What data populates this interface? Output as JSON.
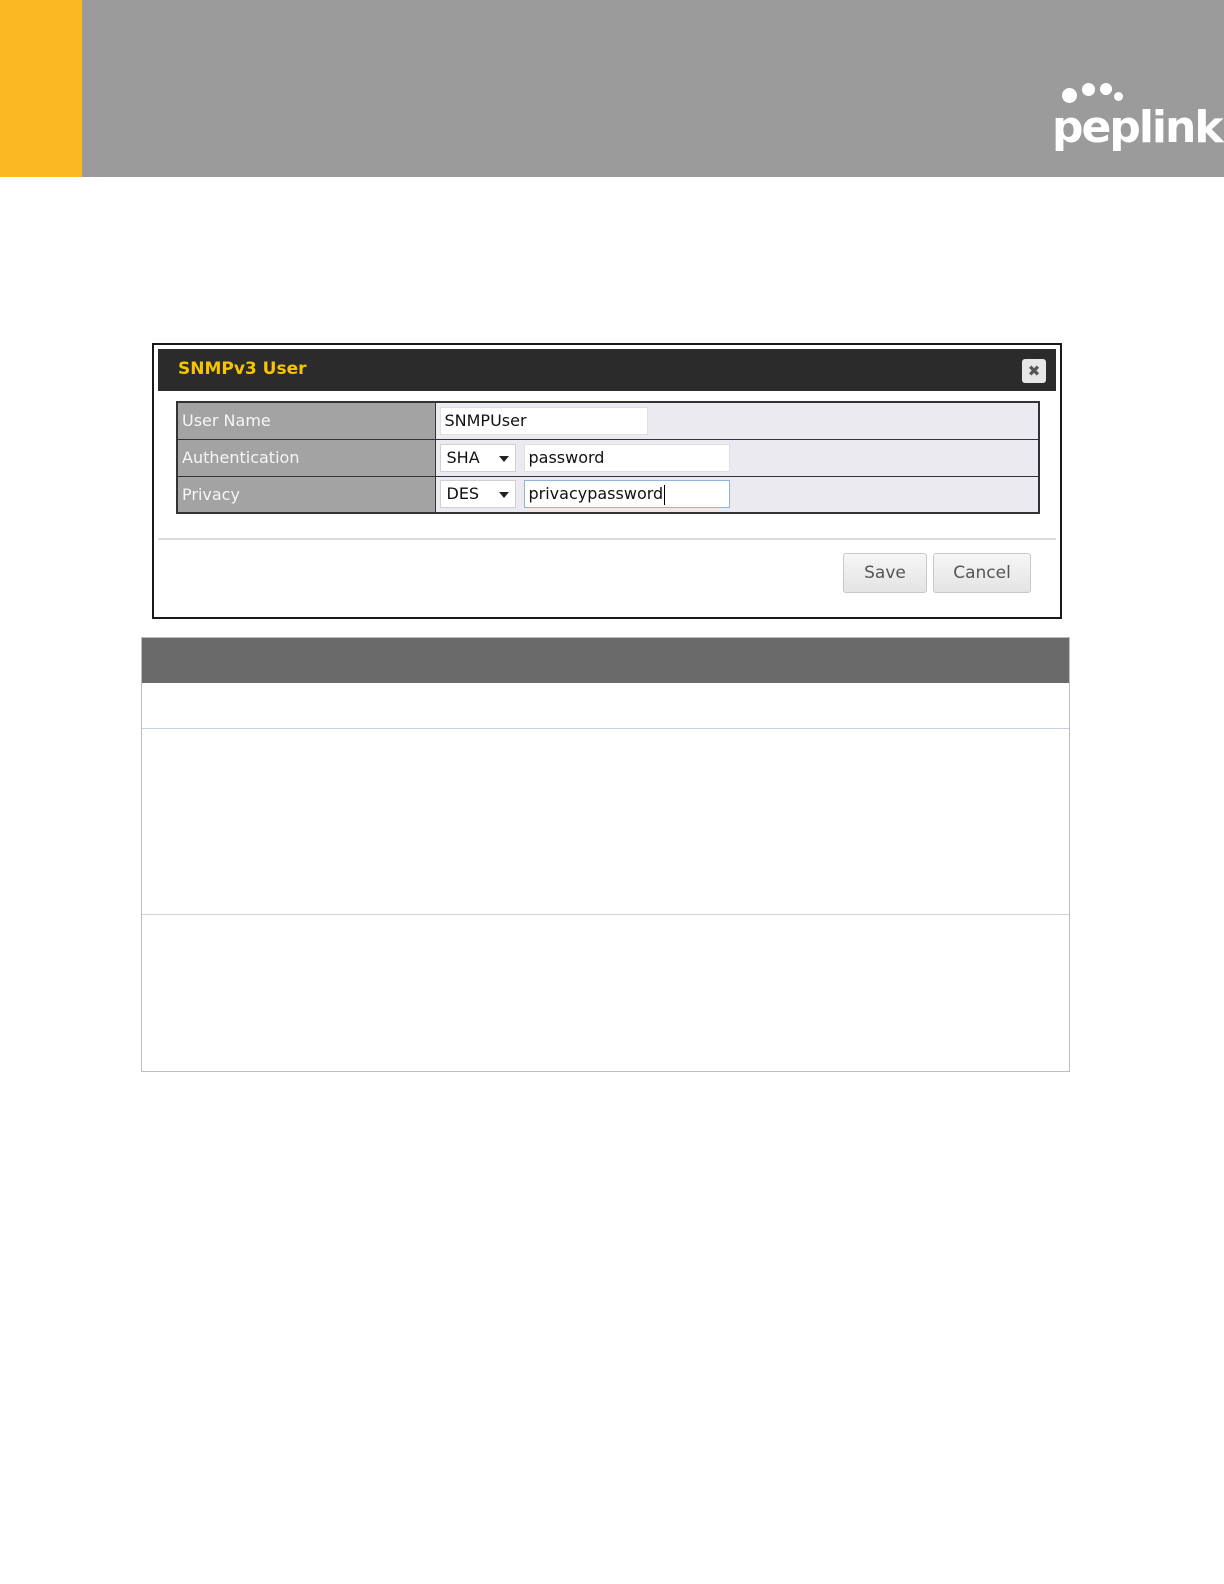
{
  "header": {
    "brand_text": "peplink",
    "brand_color": "#ffffff",
    "accent_color": "#fbb822",
    "band_color": "#9b9b9b"
  },
  "dialog": {
    "title": "SNMPv3 User",
    "close_icon": "close-icon",
    "fields": {
      "user_name": {
        "label": "User Name",
        "value": "SNMPUser"
      },
      "authentication": {
        "label": "Authentication",
        "method": "SHA",
        "value": "password"
      },
      "privacy": {
        "label": "Privacy",
        "method": "DES",
        "value": "privacypassword"
      }
    },
    "buttons": {
      "save": "Save",
      "cancel": "Cancel"
    },
    "title_color": "#f6c500"
  },
  "info_table": {
    "header": "",
    "rows": [
      "",
      "",
      ""
    ]
  }
}
